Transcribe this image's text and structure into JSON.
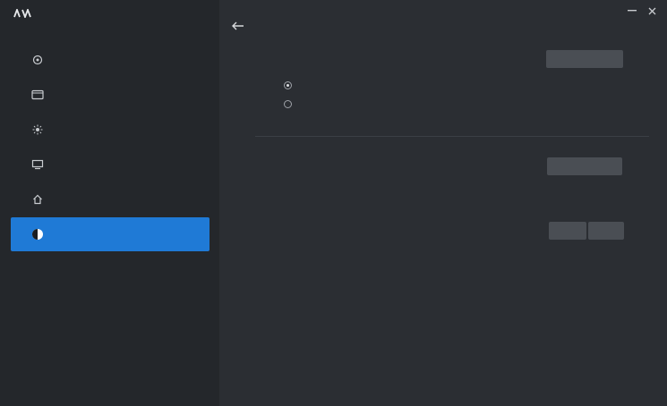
{
  "app": {
    "logo_icon": "app-logo-icon"
  },
  "window_controls": {
    "settings_label": "",
    "minimize_icon": "minimize-icon",
    "close_icon": "close-icon"
  },
  "sidebar": {
    "items": [
      {
        "label": "",
        "icon": "keyboard-icon",
        "active": false
      },
      {
        "label": "",
        "icon": "window-icon",
        "active": false
      },
      {
        "label": "",
        "icon": "color-icon",
        "active": false
      },
      {
        "label": "",
        "icon": "display-icon",
        "active": false
      },
      {
        "label": "",
        "icon": "home-icon",
        "active": false
      },
      {
        "label": "",
        "icon": "others-icon",
        "active": true
      }
    ]
  },
  "content": {
    "section_title": "",
    "configure_button": "",
    "radio_options": [
      {
        "label": "",
        "checked": true
      },
      {
        "label": "",
        "checked": false
      }
    ],
    "reset_label": "",
    "reset_button": "",
    "import_export_label": "",
    "export_button": "",
    "import_button": ""
  },
  "colors": {
    "accent": "#1f7ad6",
    "sidebar_bg": "#24272b",
    "content_bg": "#2b2e33",
    "button_bg": "#4a4e54"
  }
}
